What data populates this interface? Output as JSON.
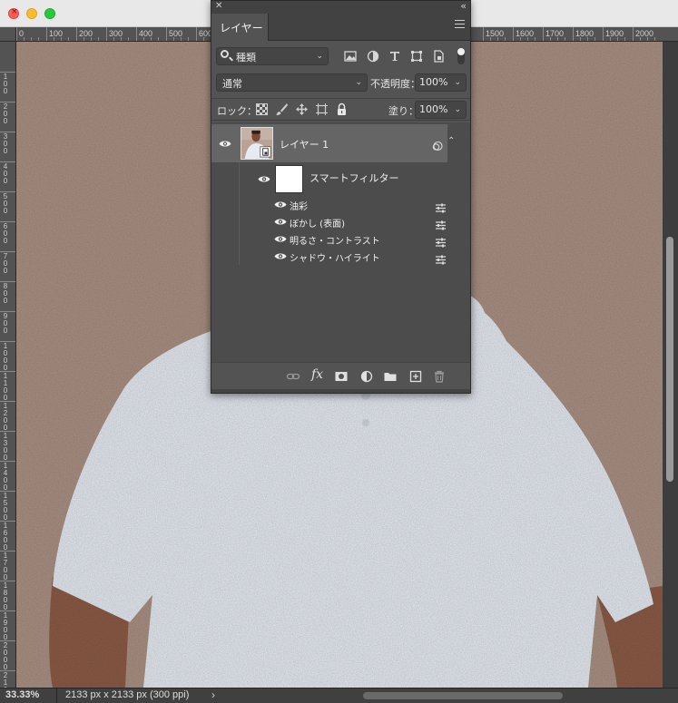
{
  "window": {
    "controls": [
      "close",
      "minimize",
      "maximize"
    ]
  },
  "ruler_top": {
    "labels": [
      "0",
      "100",
      "200",
      "300",
      "400",
      "500",
      "600",
      "1500",
      "1600",
      "1700",
      "1800",
      "1900",
      "2000"
    ]
  },
  "ruler_left": {
    "labels": [
      "100",
      "200",
      "300",
      "400",
      "500",
      "600",
      "700",
      "800",
      "900",
      "1000",
      "1100",
      "1200",
      "1300",
      "1400",
      "1500",
      "1600",
      "1700",
      "1800",
      "1900",
      "2000",
      "2100"
    ]
  },
  "status": {
    "zoom": "33.33%",
    "doc_size": "2133 px x 2133 px (300 ppi)",
    "arrow": "›"
  },
  "layers_panel": {
    "close_glyph": "✕",
    "collapse_glyph": "‹‹",
    "tab_label": "レイヤー",
    "filter_kind": "種類",
    "filter_icons": [
      "image-filter-icon",
      "adjustment-filter-icon",
      "type-filter-icon",
      "shape-filter-icon",
      "smart-object-filter-icon"
    ],
    "blend_mode": "通常",
    "opacity_label": "不透明度：",
    "opacity_value": "100%",
    "lock_label": "ロック：",
    "lock_icons": [
      "lock-transparent-icon",
      "lock-image-icon",
      "lock-position-icon",
      "lock-artboard-icon",
      "lock-all-icon"
    ],
    "fill_label": "塗り：",
    "fill_value": "100%",
    "layers": [
      {
        "name": "レイヤー 1",
        "visible": true,
        "smart_filters_label": "スマートフィルター",
        "filters": [
          {
            "name": "油彩",
            "visible": true
          },
          {
            "name": "ぼかし (表面)",
            "visible": true
          },
          {
            "name": "明るさ・コントラスト",
            "visible": true
          },
          {
            "name": "シャドウ・ハイライト",
            "visible": true
          }
        ]
      }
    ],
    "bottom_icons": [
      "link-layers-icon",
      "layer-style-icon",
      "add-mask-icon",
      "adjustment-layer-icon",
      "new-group-icon",
      "new-layer-icon",
      "trash-icon"
    ],
    "fx_label": "fx"
  },
  "canvas": {
    "background_color": "#a98f82",
    "shirt_color": "#e3e8ef",
    "skin_color": "#8a5a45"
  }
}
